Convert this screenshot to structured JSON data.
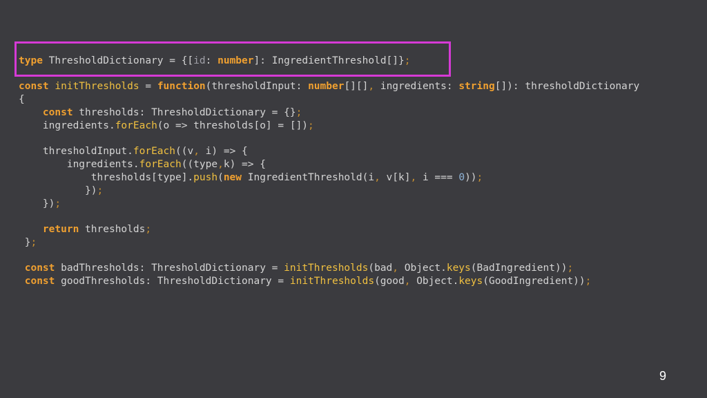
{
  "slide": {
    "page_number": "9",
    "highlight_color": "#d63ad6",
    "background": "#3b3b3f"
  },
  "code": {
    "l1": [
      "type",
      " ThresholdDictionary = {[",
      "id",
      ": ",
      "number",
      "]: IngredientThreshold[]}",
      ";"
    ],
    "l2": [
      "const",
      " ",
      "initThresholds",
      " = ",
      "function",
      "(thresholdInput: ",
      "number",
      "[][]",
      ",",
      " ingredients: ",
      "string",
      "[]): thresholdDictionary"
    ],
    "l3": [
      "{"
    ],
    "l4": [
      "    ",
      "const",
      " thresholds: ThresholdDictionary = {}",
      ";"
    ],
    "l5": [
      "    ingredients.",
      "forEach",
      "(o => thresholds[o] = [])",
      ";"
    ],
    "l6": [
      "    thresholdInput.",
      "forEach",
      "((v",
      ",",
      " i) => {"
    ],
    "l7": [
      "        ingredients.",
      "forEach",
      "((type",
      ",",
      "k) => {"
    ],
    "l8": [
      "            thresholds[type].",
      "push",
      "(",
      "new",
      " IngredientThreshold(i",
      ",",
      " v[k]",
      ",",
      " i === ",
      "0",
      "))",
      ";"
    ],
    "l9": [
      "           })",
      ";"
    ],
    "l10": [
      "    })",
      ";"
    ],
    "l11": [
      "    ",
      "return",
      " thresholds",
      ";"
    ],
    "l12": [
      " }",
      ";"
    ],
    "l13": [
      " ",
      "const",
      " badThresholds: ThresholdDictionary = ",
      "initThresholds",
      "(bad",
      ",",
      " Object.",
      "keys",
      "(BadIngredient))",
      ";"
    ],
    "l14": [
      " ",
      "const",
      " goodThresholds: ThresholdDictionary = ",
      "initThresholds",
      "(good",
      ",",
      " Object.",
      "keys",
      "(GoodIngredient))",
      ";"
    ]
  }
}
